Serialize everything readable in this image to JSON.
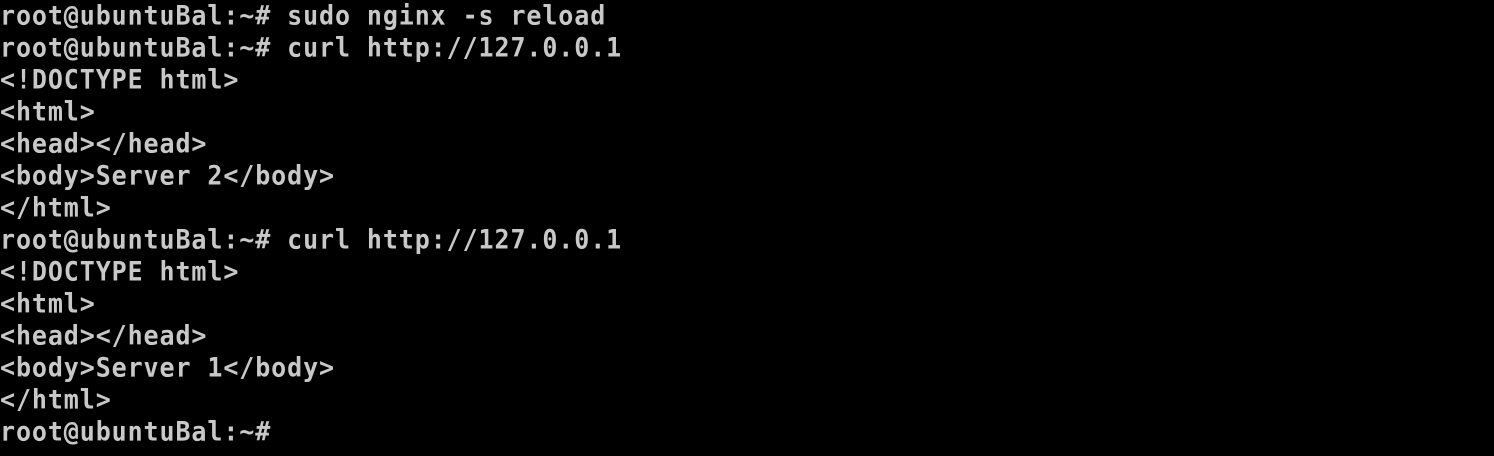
{
  "terminal": {
    "lines": [
      "root@ubuntuBal:~# sudo nginx -s reload",
      "root@ubuntuBal:~# curl http://127.0.0.1",
      "<!DOCTYPE html>",
      "<html>",
      "<head></head>",
      "<body>Server 2</body>",
      "</html>",
      "root@ubuntuBal:~# curl http://127.0.0.1",
      "<!DOCTYPE html>",
      "<html>",
      "<head></head>",
      "<body>Server 1</body>",
      "</html>",
      "root@ubuntuBal:~#"
    ],
    "colors": {
      "background": "#000000",
      "foreground": "#c8c8c8"
    }
  }
}
